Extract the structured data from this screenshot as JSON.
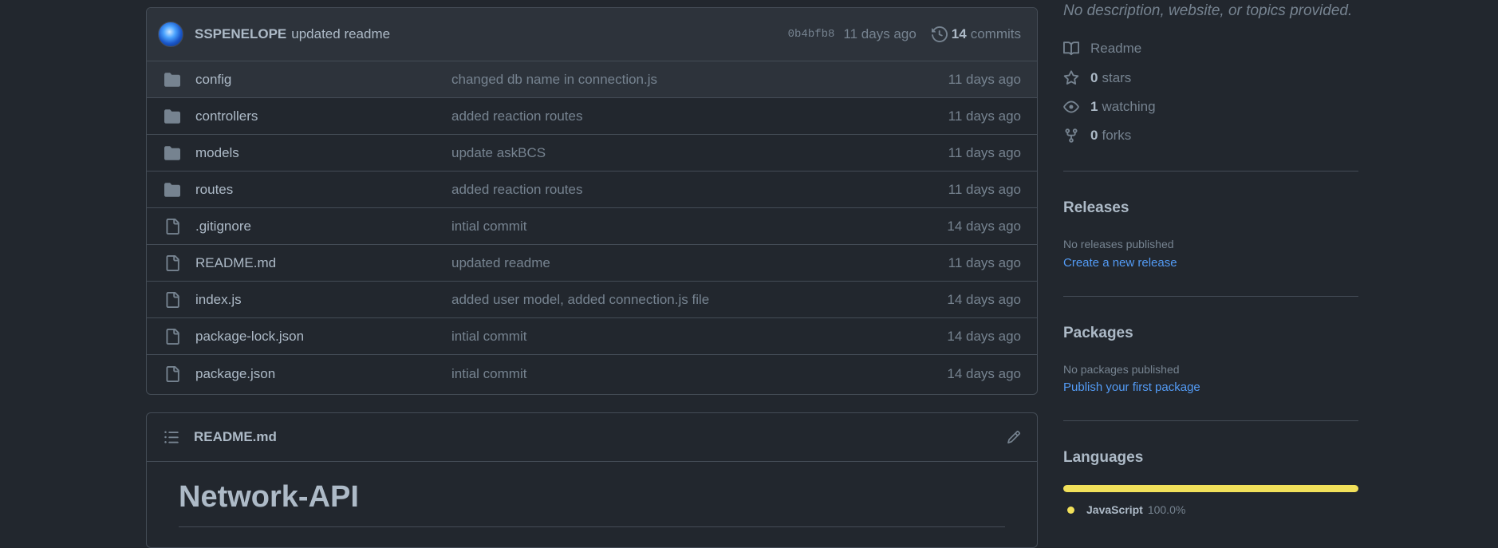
{
  "commit": {
    "author": "SSPENELOPE",
    "message": "updated readme",
    "sha": "0b4bfb8",
    "time": "11 days ago",
    "count": "14",
    "count_label": "commits"
  },
  "files": [
    {
      "type": "folder",
      "name": "config",
      "message": "changed db name in connection.js",
      "age": "11 days ago"
    },
    {
      "type": "folder",
      "name": "controllers",
      "message": "added reaction routes",
      "age": "11 days ago"
    },
    {
      "type": "folder",
      "name": "models",
      "message": "update askBCS",
      "age": "11 days ago"
    },
    {
      "type": "folder",
      "name": "routes",
      "message": "added reaction routes",
      "age": "11 days ago"
    },
    {
      "type": "file",
      "name": ".gitignore",
      "message": "intial commit",
      "age": "14 days ago"
    },
    {
      "type": "file",
      "name": "README.md",
      "message": "updated readme",
      "age": "11 days ago"
    },
    {
      "type": "file",
      "name": "index.js",
      "message": "added user model, added connection.js file",
      "age": "14 days ago"
    },
    {
      "type": "file",
      "name": "package-lock.json",
      "message": "intial commit",
      "age": "14 days ago"
    },
    {
      "type": "file",
      "name": "package.json",
      "message": "intial commit",
      "age": "14 days ago"
    }
  ],
  "readme": {
    "filename": "README.md",
    "heading": "Network-API"
  },
  "about": {
    "description": "No description, website, or topics provided.",
    "readme_label": "Readme",
    "stars_count": "0",
    "stars_label": "stars",
    "watching_count": "1",
    "watching_label": "watching",
    "forks_count": "0",
    "forks_label": "forks"
  },
  "releases": {
    "title": "Releases",
    "empty": "No releases published",
    "link": "Create a new release"
  },
  "packages": {
    "title": "Packages",
    "empty": "No packages published",
    "link": "Publish your first package"
  },
  "languages": {
    "title": "Languages",
    "items": [
      {
        "name": "JavaScript",
        "percent": "100.0%",
        "fraction": 1.0,
        "color": "#f1e05a"
      }
    ]
  },
  "colors": {
    "background": "#22272e",
    "border": "#444c56",
    "link": "#539bf5",
    "muted": "#768390",
    "text": "#adbac7"
  },
  "icons": {
    "folder": "folder-icon",
    "file": "file-icon",
    "history": "history-icon",
    "list": "list-icon",
    "edit": "pencil-icon",
    "book": "book-icon",
    "star": "star-icon",
    "eye": "eye-icon",
    "fork": "fork-icon"
  }
}
